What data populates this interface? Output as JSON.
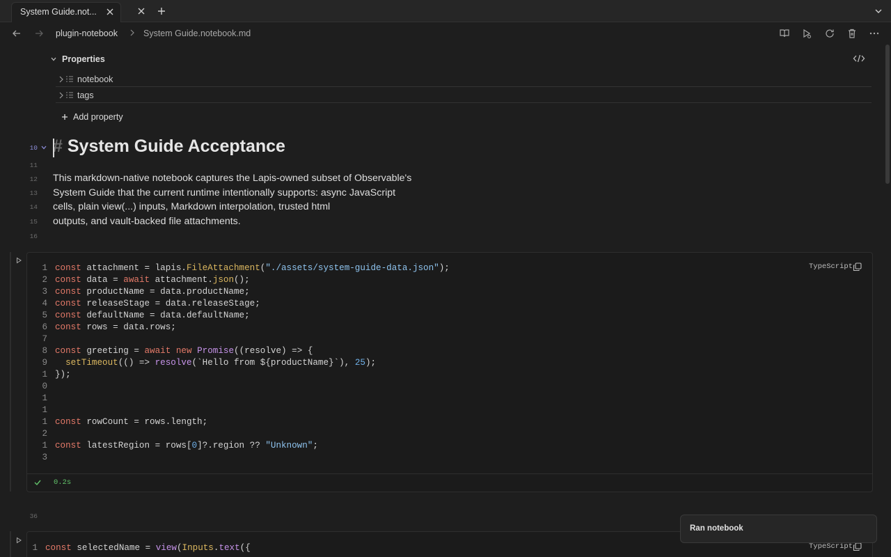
{
  "tabbar": {
    "active_tab_title": "System Guide.not...",
    "close_icon": "close-icon",
    "new_tab_icon": "plus-icon",
    "tab_list_icon": "chevron-down-icon"
  },
  "navbar": {
    "breadcrumb_folder": "plugin-notebook",
    "breadcrumb_file": "System Guide.notebook.md",
    "actions": [
      "book-open-icon",
      "play-icon",
      "refresh-icon",
      "trash-icon",
      "more-icon"
    ]
  },
  "properties": {
    "title": "Properties",
    "items": [
      {
        "name": "notebook"
      },
      {
        "name": "tags"
      }
    ],
    "add_label": "Add property"
  },
  "document": {
    "heading_hash": "#",
    "heading_text": "System Guide Acceptance",
    "line_numbers": {
      "heading": "10",
      "l11": "11",
      "l12": "12",
      "l13": "13",
      "l14": "14",
      "l15": "15",
      "l16": "16",
      "l36": "36"
    },
    "paragraph_lines": [
      "This markdown-native notebook captures the Lapis-owned subset of Observable's",
      "System Guide that the current runtime intentionally supports: async JavaScript",
      "cells, plain view(...) inputs, Markdown interpolation, trusted html",
      "outputs, and vault-backed file attachments."
    ]
  },
  "cell1": {
    "language": "TypeScript",
    "status_time": "0.2s",
    "line_numbers": [
      "1",
      "2",
      "3",
      "4",
      "5",
      "6",
      "7",
      "8",
      "9",
      "1",
      "0",
      "1",
      "1",
      "1",
      "2",
      "1",
      "3"
    ]
  },
  "cell2": {
    "language": "TypeScript",
    "line_numbers": [
      "1"
    ]
  },
  "toast": {
    "message": "Ran notebook"
  },
  "colors": {
    "background": "#1e1e1e",
    "keyword": "#e57a69",
    "function": "#dcb860",
    "method": "#c693e9",
    "string": "#8fc4ef",
    "success": "#62c26a"
  }
}
